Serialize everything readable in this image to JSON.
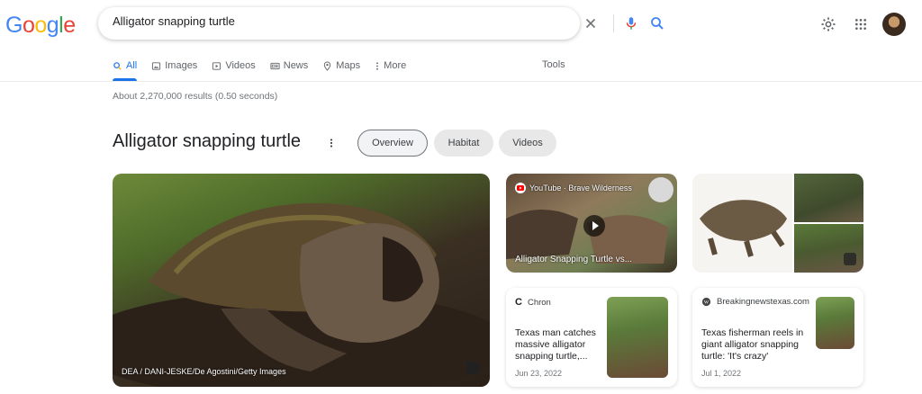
{
  "logo": {
    "letters": [
      "G",
      "o",
      "o",
      "g",
      "l",
      "e"
    ],
    "colors": [
      "#4285f4",
      "#ea4335",
      "#fbbc05",
      "#4285f4",
      "#34a853",
      "#ea4335"
    ]
  },
  "search": {
    "query": "Alligator snapping turtle"
  },
  "tabs": [
    {
      "label": "All",
      "icon": "search-icon",
      "active": true
    },
    {
      "label": "Images",
      "icon": "image-icon"
    },
    {
      "label": "Videos",
      "icon": "video-play-icon"
    },
    {
      "label": "News",
      "icon": "news-icon"
    },
    {
      "label": "Maps",
      "icon": "map-pin-icon"
    },
    {
      "label": "More",
      "icon": "more-vertical-icon"
    }
  ],
  "tools_label": "Tools",
  "result_stats": "About 2,270,000 results (0.50 seconds)",
  "knowledge_panel": {
    "title": "Alligator snapping turtle",
    "chips": [
      "Overview",
      "Habitat",
      "Videos"
    ],
    "main_image_credit": "DEA / DANI-JESKE/De Agostini/Getty Images",
    "video": {
      "source": "YouTube · Brave Wilderness",
      "title": "Alligator Snapping Turtle vs..."
    },
    "news": [
      {
        "source": "Chron",
        "title": "Texas man catches massive alligator snapping turtle,...",
        "date": "Jun 23, 2022"
      },
      {
        "source": "Breakingnewstexas.com",
        "title": "Texas fisherman reels in giant alligator snapping turtle: 'It's crazy'",
        "date": "Jul 1, 2022"
      }
    ]
  },
  "colors": {
    "accent": "#1a73e8",
    "text": "#202124",
    "muted": "#70757a"
  }
}
